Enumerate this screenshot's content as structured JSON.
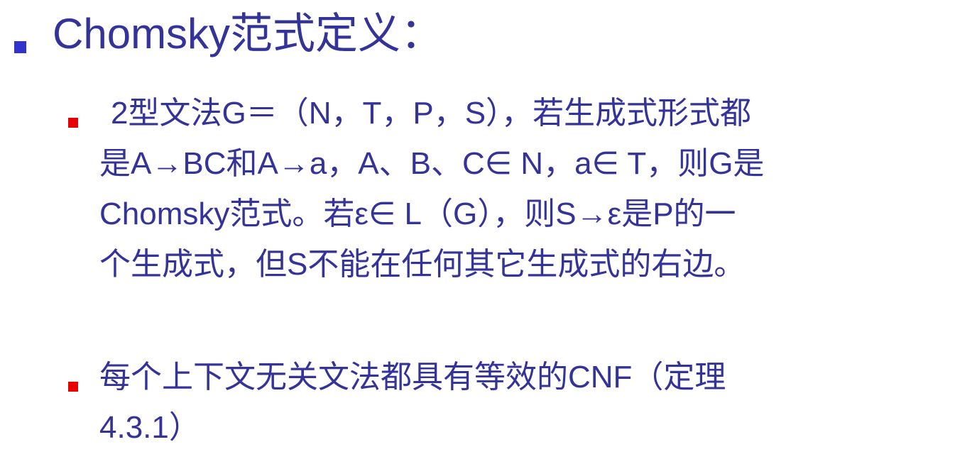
{
  "slide": {
    "title": "Chomsky范式定义：",
    "items": [
      {
        "lines": [
          "2型文法G＝（N，T，P，S），若生成式形式都",
          "是A→BC和A→a，A、B、C∈ N，a∈ T，则G是",
          "Chomsky范式。若ε∈ L（G），则S→ε是P的一",
          "个生成式，但S不能在任何其它生成式的右边。"
        ]
      },
      {
        "lines": [
          "每个上下文无关文法都具有等效的CNF（定理",
          "4.3.1）"
        ]
      }
    ]
  },
  "colors": {
    "text": "#33339a",
    "level1_bullet": "#3333cc",
    "level2_bullet": "#e60000"
  }
}
